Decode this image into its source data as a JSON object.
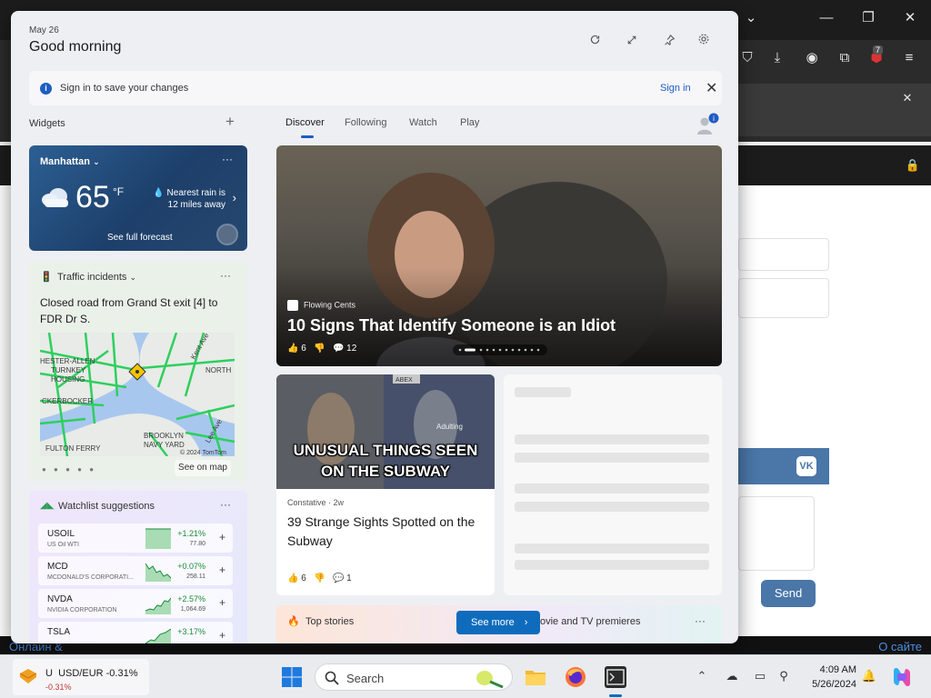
{
  "background": {
    "bottom_left_text": "Онлайн &",
    "bottom_right_text": "O сайте",
    "send_button": "Send",
    "extension_badge": "7",
    "vk_logo": "VK"
  },
  "widgets": {
    "date": "May 26",
    "greeting": "Good morning",
    "header_icons": [
      "refresh-icon",
      "expand-icon",
      "pin-icon",
      "gear-icon"
    ],
    "signin_bar": {
      "message": "Sign in to save your changes",
      "link": "Sign in"
    },
    "section_label": "Widgets",
    "weather": {
      "location": "Manhattan",
      "temperature": "65",
      "unit": "°F",
      "rain": "Nearest rain is 12 miles away",
      "forecast_link": "See full forecast"
    },
    "traffic": {
      "title": "Traffic incidents",
      "description": "Closed road from Grand St exit [4] to FDR Dr S.",
      "map_labels": {
        "lester_allen": "HESTER-ALLEN",
        "turnkey": "TURNKEY",
        "housing": "HOUSING",
        "knickerbocker": "CKERBOCKER",
        "fulton_ferry": "FULTON FERRY",
        "brooklyn_navy": "BROOKLYN",
        "navy_yard": "NAVY YARD",
        "north": "NORTH",
        "kent_ave": "Kent Ave",
        "lee_ave": "Lee Ave",
        "copyright": "© 2024 TomTom"
      },
      "see_on_map": "See on map"
    },
    "watchlist": {
      "title": "Watchlist suggestions",
      "stocks": [
        {
          "symbol": "USOIL",
          "name": "US Oil WTI",
          "change": "+1.21%",
          "price": "77.80"
        },
        {
          "symbol": "MCD",
          "name": "MCDONALD'S CORPORATI...",
          "change": "+0.07%",
          "price": "258.11"
        },
        {
          "symbol": "NVDA",
          "name": "NVIDIA CORPORATION",
          "change": "+2.57%",
          "price": "1,064.69"
        },
        {
          "symbol": "TSLA",
          "name": "",
          "change": "+3.17%",
          "price": ""
        }
      ]
    },
    "feed_tabs": [
      "Discover",
      "Following",
      "Watch",
      "Play"
    ],
    "profile_badge": "i",
    "hero": {
      "source": "Flowing Cents",
      "headline": "10 Signs That Identify Someone is an Idiot",
      "likes": "6",
      "comments": "12"
    },
    "subway": {
      "image_caption_1": "UNUSUAL THINGS SEEN",
      "image_caption_2": "ON THE SUBWAY",
      "sign_1": "ABEX",
      "sign_2": "Adulting",
      "source": "Constative · 2w",
      "headline": "39 Strange Sights Spotted on the Subway",
      "likes": "6",
      "comments": "1"
    },
    "top_stories": {
      "label": "Top stories",
      "see_more": "See more",
      "movie_label": "ovie and TV premieres"
    }
  },
  "taskbar": {
    "ticker_text": "USD/EUR -0.31%",
    "ticker_prefix": "U",
    "ticker_sub": "-0.31%",
    "search_label": "Search",
    "time": "4:09 AM",
    "date": "5/26/2024"
  }
}
